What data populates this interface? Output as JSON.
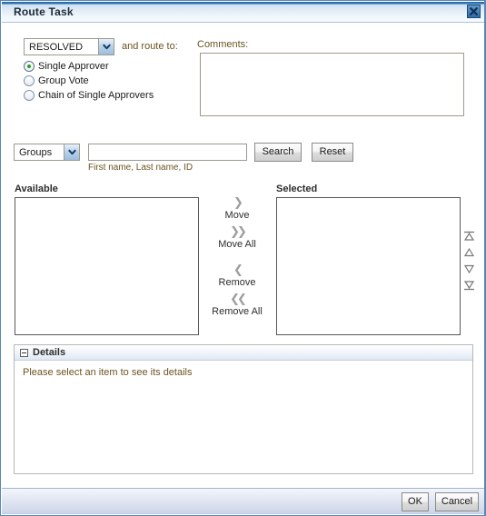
{
  "window": {
    "title": "Route Task",
    "close_icon": "close-icon"
  },
  "routing": {
    "outcome_select": {
      "value": "RESOLVED",
      "options": [
        "RESOLVED"
      ]
    },
    "and_route_to_label": "and route to:",
    "radio_options": [
      {
        "label": "Single Approver",
        "checked": true
      },
      {
        "label": "Group Vote",
        "checked": false
      },
      {
        "label": "Chain of Single Approvers",
        "checked": false
      }
    ]
  },
  "comments": {
    "label": "Comments:",
    "value": "",
    "placeholder": ""
  },
  "search": {
    "type_select": {
      "value": "Groups",
      "options": [
        "Groups"
      ]
    },
    "input_value": "",
    "input_placeholder": "",
    "hint": "First name, Last name, ID",
    "search_button": "Search",
    "reset_button": "Reset"
  },
  "shuttle": {
    "available_label": "Available",
    "selected_label": "Selected",
    "available_items": [],
    "selected_items": [],
    "move_buttons": [
      {
        "label": "Move",
        "icon": "chevron-right-icon",
        "glyph": "❯"
      },
      {
        "label": "Move All",
        "icon": "chevron-double-right-icon",
        "glyph": "❯❯"
      },
      {
        "label": "Remove",
        "icon": "chevron-left-icon",
        "glyph": "❮"
      },
      {
        "label": "Remove All",
        "icon": "chevron-double-left-icon",
        "glyph": "❮❮"
      }
    ],
    "reorder_buttons": [
      {
        "name": "move-to-top-button",
        "icon": "arrow-to-top-icon"
      },
      {
        "name": "move-up-button",
        "icon": "arrow-up-icon"
      },
      {
        "name": "move-down-button",
        "icon": "arrow-down-icon"
      },
      {
        "name": "move-to-bottom-button",
        "icon": "arrow-to-bottom-icon"
      }
    ]
  },
  "details": {
    "header": "Details",
    "message": "Please select an item to see its details",
    "expanded": true
  },
  "footer": {
    "ok_button": "OK",
    "cancel_button": "Cancel"
  },
  "colors": {
    "title_accent": "#2a6faf",
    "label_brown": "#6b5420",
    "radio_dot_green": "#2aa02a",
    "window_border": "#5a87b5"
  }
}
